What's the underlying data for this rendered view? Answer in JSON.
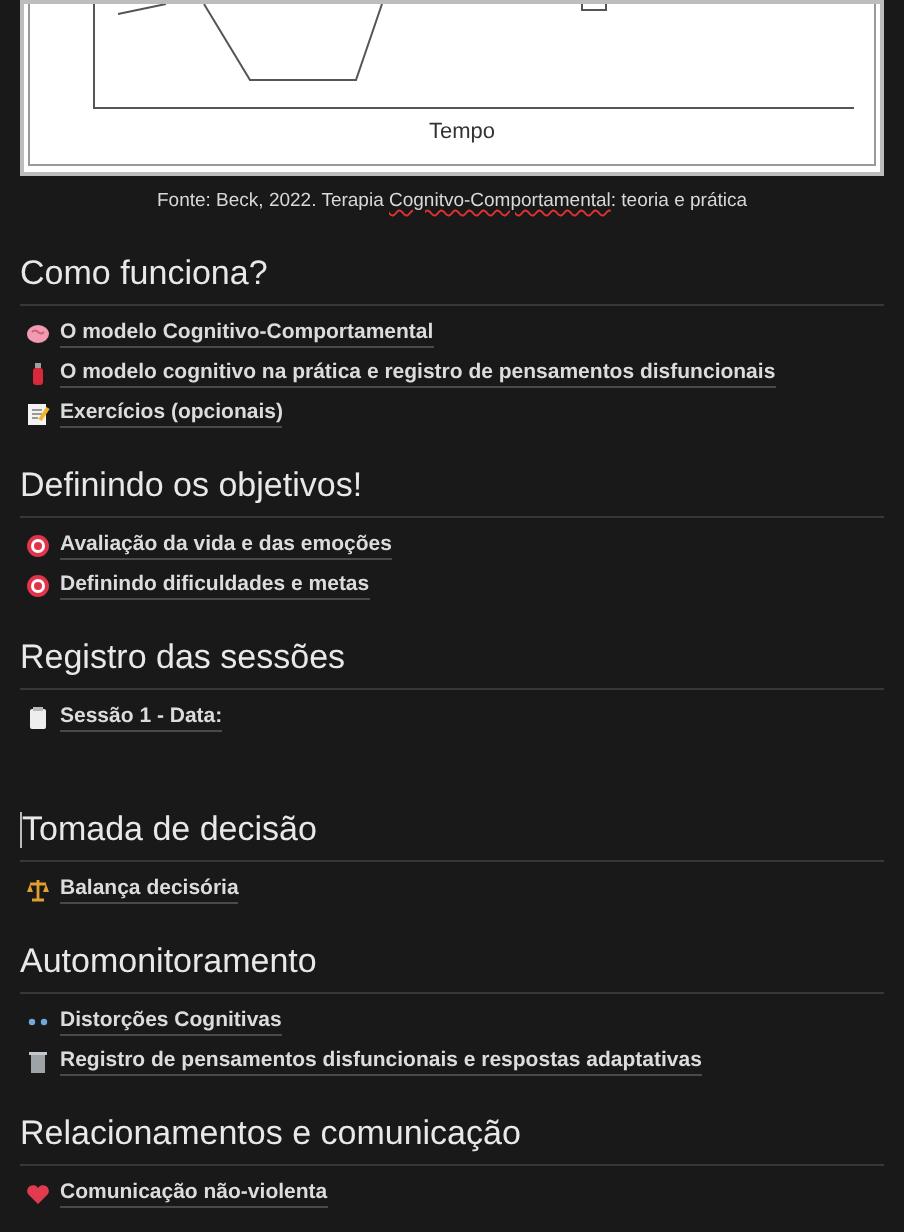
{
  "figure": {
    "axis_label": "Tempo"
  },
  "caption": {
    "before": "Fonte: Beck, 2022. Terapia ",
    "misspelled": "Cognitvo-Comportamental",
    "after": ": teoria e prática"
  },
  "sections": [
    {
      "title": "Como funciona?",
      "cursor": false,
      "items": [
        {
          "label": "O modelo Cognitivo-Comportamental",
          "kind": "brain"
        },
        {
          "label": "O modelo cognitivo na prática e registro de pensamentos disfuncionais",
          "kind": "fire-extinguisher"
        },
        {
          "label": "Exercícios (opcionais)",
          "kind": "memo"
        }
      ]
    },
    {
      "title": "Definindo os objetivos!",
      "cursor": false,
      "items": [
        {
          "label": "Avaliação da vida e das emoções",
          "kind": "target"
        },
        {
          "label": "Definindo dificuldades e metas",
          "kind": "target"
        }
      ]
    },
    {
      "title": "Registro das sessões",
      "cursor": false,
      "items": [
        {
          "label": "Sessão 1 - Data:",
          "kind": "notepad"
        }
      ]
    },
    {
      "title": "Tomada de decisão",
      "cursor": true,
      "items": [
        {
          "label": "Balança decisória",
          "kind": "scales"
        }
      ]
    },
    {
      "title": "Automonitoramento",
      "cursor": false,
      "items": [
        {
          "label": "Distorções Cognitivas",
          "kind": "dots"
        },
        {
          "label": "Registro de pensamentos disfuncionais e respostas adaptativas",
          "kind": "trash"
        }
      ]
    },
    {
      "title": "Relacionamentos e comunicação",
      "cursor": false,
      "items": [
        {
          "label": "Comunicação não-violenta",
          "kind": "heart"
        }
      ]
    }
  ]
}
